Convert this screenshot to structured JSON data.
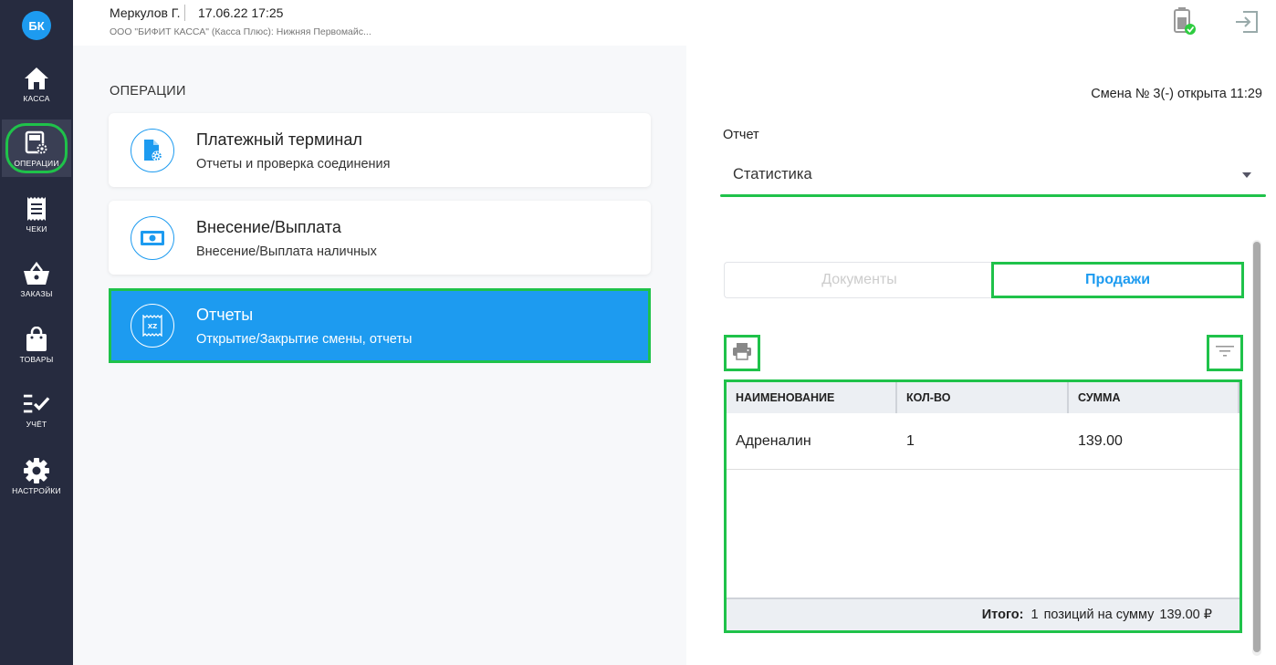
{
  "sidebar": {
    "avatar": "БК",
    "items": [
      {
        "label": "КАССА",
        "icon": "home-icon"
      },
      {
        "label": "ОПЕРАЦИИ",
        "icon": "operations-icon"
      },
      {
        "label": "ЧЕКИ",
        "icon": "receipt-icon"
      },
      {
        "label": "ЗАКАЗЫ",
        "icon": "basket-icon"
      },
      {
        "label": "ТОВАРЫ",
        "icon": "bag-icon"
      },
      {
        "label": "УЧЁТ",
        "icon": "checklist-icon"
      },
      {
        "label": "НАСТРОЙКИ",
        "icon": "gear-icon"
      }
    ],
    "active_index": 1
  },
  "header": {
    "user": "Меркулов Г.",
    "datetime": "17.06.22 17:25",
    "organization": "ООО \"БИФИТ КАССА\" (Касса Плюс): Нижняя Первомайс..."
  },
  "operations": {
    "title": "ОПЕРАЦИИ",
    "cards": [
      {
        "title": "Платежный терминал",
        "subtitle": "Отчеты и проверка соединения",
        "icon": "payment-terminal-icon"
      },
      {
        "title": "Внесение/Выплата",
        "subtitle": "Внесение/Выплата наличных",
        "icon": "cash-icon"
      },
      {
        "title": "Отчеты",
        "subtitle": "Открытие/Закрытие смены, отчеты",
        "icon": "xz-report-icon"
      }
    ],
    "active_index": 2
  },
  "report": {
    "shift_status": "Смена № 3(-) открыта 11:29",
    "label": "Отчет",
    "selected": "Статистика",
    "tabs": {
      "documents": "Документы",
      "sales": "Продажи"
    },
    "active_tab": "sales",
    "table": {
      "headers": [
        "НАИМЕНОВАНИЕ",
        "КОЛ-ВО",
        "СУММА"
      ],
      "rows": [
        {
          "name": "Адреналин",
          "qty": "1",
          "sum": "139.00"
        }
      ],
      "footer": {
        "total_label": "Итого:",
        "count": "1",
        "text": "позиций на сумму",
        "amount": "139.00 ₽"
      }
    }
  },
  "colors": {
    "sidebar": "#262b3f",
    "accent": "#1d9bf0",
    "highlight": "#1fc24a"
  }
}
